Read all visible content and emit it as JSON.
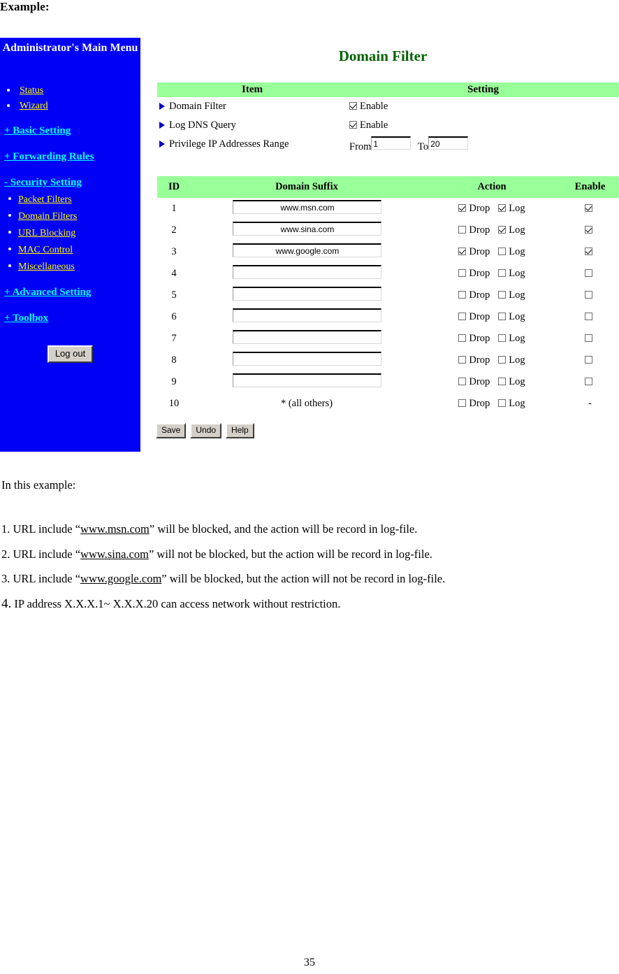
{
  "document": {
    "heading": "Example:",
    "page_number": "35",
    "intro": "In this example:",
    "notes": [
      {
        "number": "1.",
        "pre": "URL include “",
        "link": "www.msn.com",
        "post": "” will be blocked, and the action will be record in log-file."
      },
      {
        "number": "2.",
        "pre": "URL include “",
        "link": "www.sina.com",
        "post": "” will not be blocked, but the action will be record in log-file."
      },
      {
        "number": "3.",
        "pre": "URL include “",
        "link": "www.google.com",
        "post": "” will be blocked, but the action will not be record in log-file."
      },
      {
        "number": "4.",
        "pre": "",
        "link": "",
        "post": "IP address X.X.X.1~ X.X.X.20 can access network without restriction."
      }
    ]
  },
  "colors": {
    "sidebar_bg": "#0000f5",
    "table_header_green": "#99ff99",
    "title_green": "#006400",
    "link_yellow": "#ffff00",
    "link_cyan": "#00ffff"
  },
  "sidebar": {
    "title": "Administrator's Main Menu",
    "bullets": [
      {
        "label": "Status"
      },
      {
        "label": "Wizard"
      }
    ],
    "groups": [
      {
        "label": "+ Basic Setting",
        "children": []
      },
      {
        "label": "+ Forwarding Rules",
        "children": []
      },
      {
        "label": "- Security Setting",
        "children": [
          {
            "label": "Packet Filters"
          },
          {
            "label": "Domain Filters"
          },
          {
            "label": "URL Blocking"
          },
          {
            "label": "MAC Control"
          },
          {
            "label": "Miscellaneous"
          }
        ]
      },
      {
        "label": "+ Advanced Setting",
        "children": []
      },
      {
        "label": "+ Toolbox",
        "children": []
      }
    ],
    "logout_label": "Log out"
  },
  "main": {
    "title": "Domain Filter",
    "settings_headers": [
      "Item",
      "Setting"
    ],
    "settings_rows": [
      {
        "item": "Domain Filter",
        "type": "checkbox",
        "checkbox_label": "Enable",
        "checked": true
      },
      {
        "item": "Log DNS Query",
        "type": "checkbox",
        "checkbox_label": "Enable",
        "checked": true
      },
      {
        "item": "Privilege IP Addresses Range",
        "type": "range",
        "from_label": "From",
        "from_value": "1",
        "to_label": "To",
        "to_value": "20"
      }
    ],
    "filter_headers": [
      "ID",
      "Domain Suffix",
      "Action",
      "Enable"
    ],
    "action_labels": {
      "drop": "Drop",
      "log": "Log"
    },
    "filter_rows": [
      {
        "id": "1",
        "suffix": "www.msn.com",
        "drop": true,
        "log": true,
        "enable": true,
        "enable_type": "checkbox"
      },
      {
        "id": "2",
        "suffix": "www.sina.com",
        "drop": false,
        "log": true,
        "enable": true,
        "enable_type": "checkbox"
      },
      {
        "id": "3",
        "suffix": "www.google.com",
        "drop": true,
        "log": false,
        "enable": true,
        "enable_type": "checkbox"
      },
      {
        "id": "4",
        "suffix": "",
        "drop": false,
        "log": false,
        "enable": false,
        "enable_type": "checkbox"
      },
      {
        "id": "5",
        "suffix": "",
        "drop": false,
        "log": false,
        "enable": false,
        "enable_type": "checkbox"
      },
      {
        "id": "6",
        "suffix": "",
        "drop": false,
        "log": false,
        "enable": false,
        "enable_type": "checkbox"
      },
      {
        "id": "7",
        "suffix": "",
        "drop": false,
        "log": false,
        "enable": false,
        "enable_type": "checkbox"
      },
      {
        "id": "8",
        "suffix": "",
        "drop": false,
        "log": false,
        "enable": false,
        "enable_type": "checkbox"
      },
      {
        "id": "9",
        "suffix": "",
        "drop": false,
        "log": false,
        "enable": false,
        "enable_type": "checkbox"
      },
      {
        "id": "10",
        "suffix": "* (all others)",
        "drop": false,
        "log": false,
        "enable": "-",
        "enable_type": "text"
      }
    ],
    "buttons": [
      {
        "label": "Save"
      },
      {
        "label": "Undo"
      },
      {
        "label": "Help"
      }
    ]
  }
}
